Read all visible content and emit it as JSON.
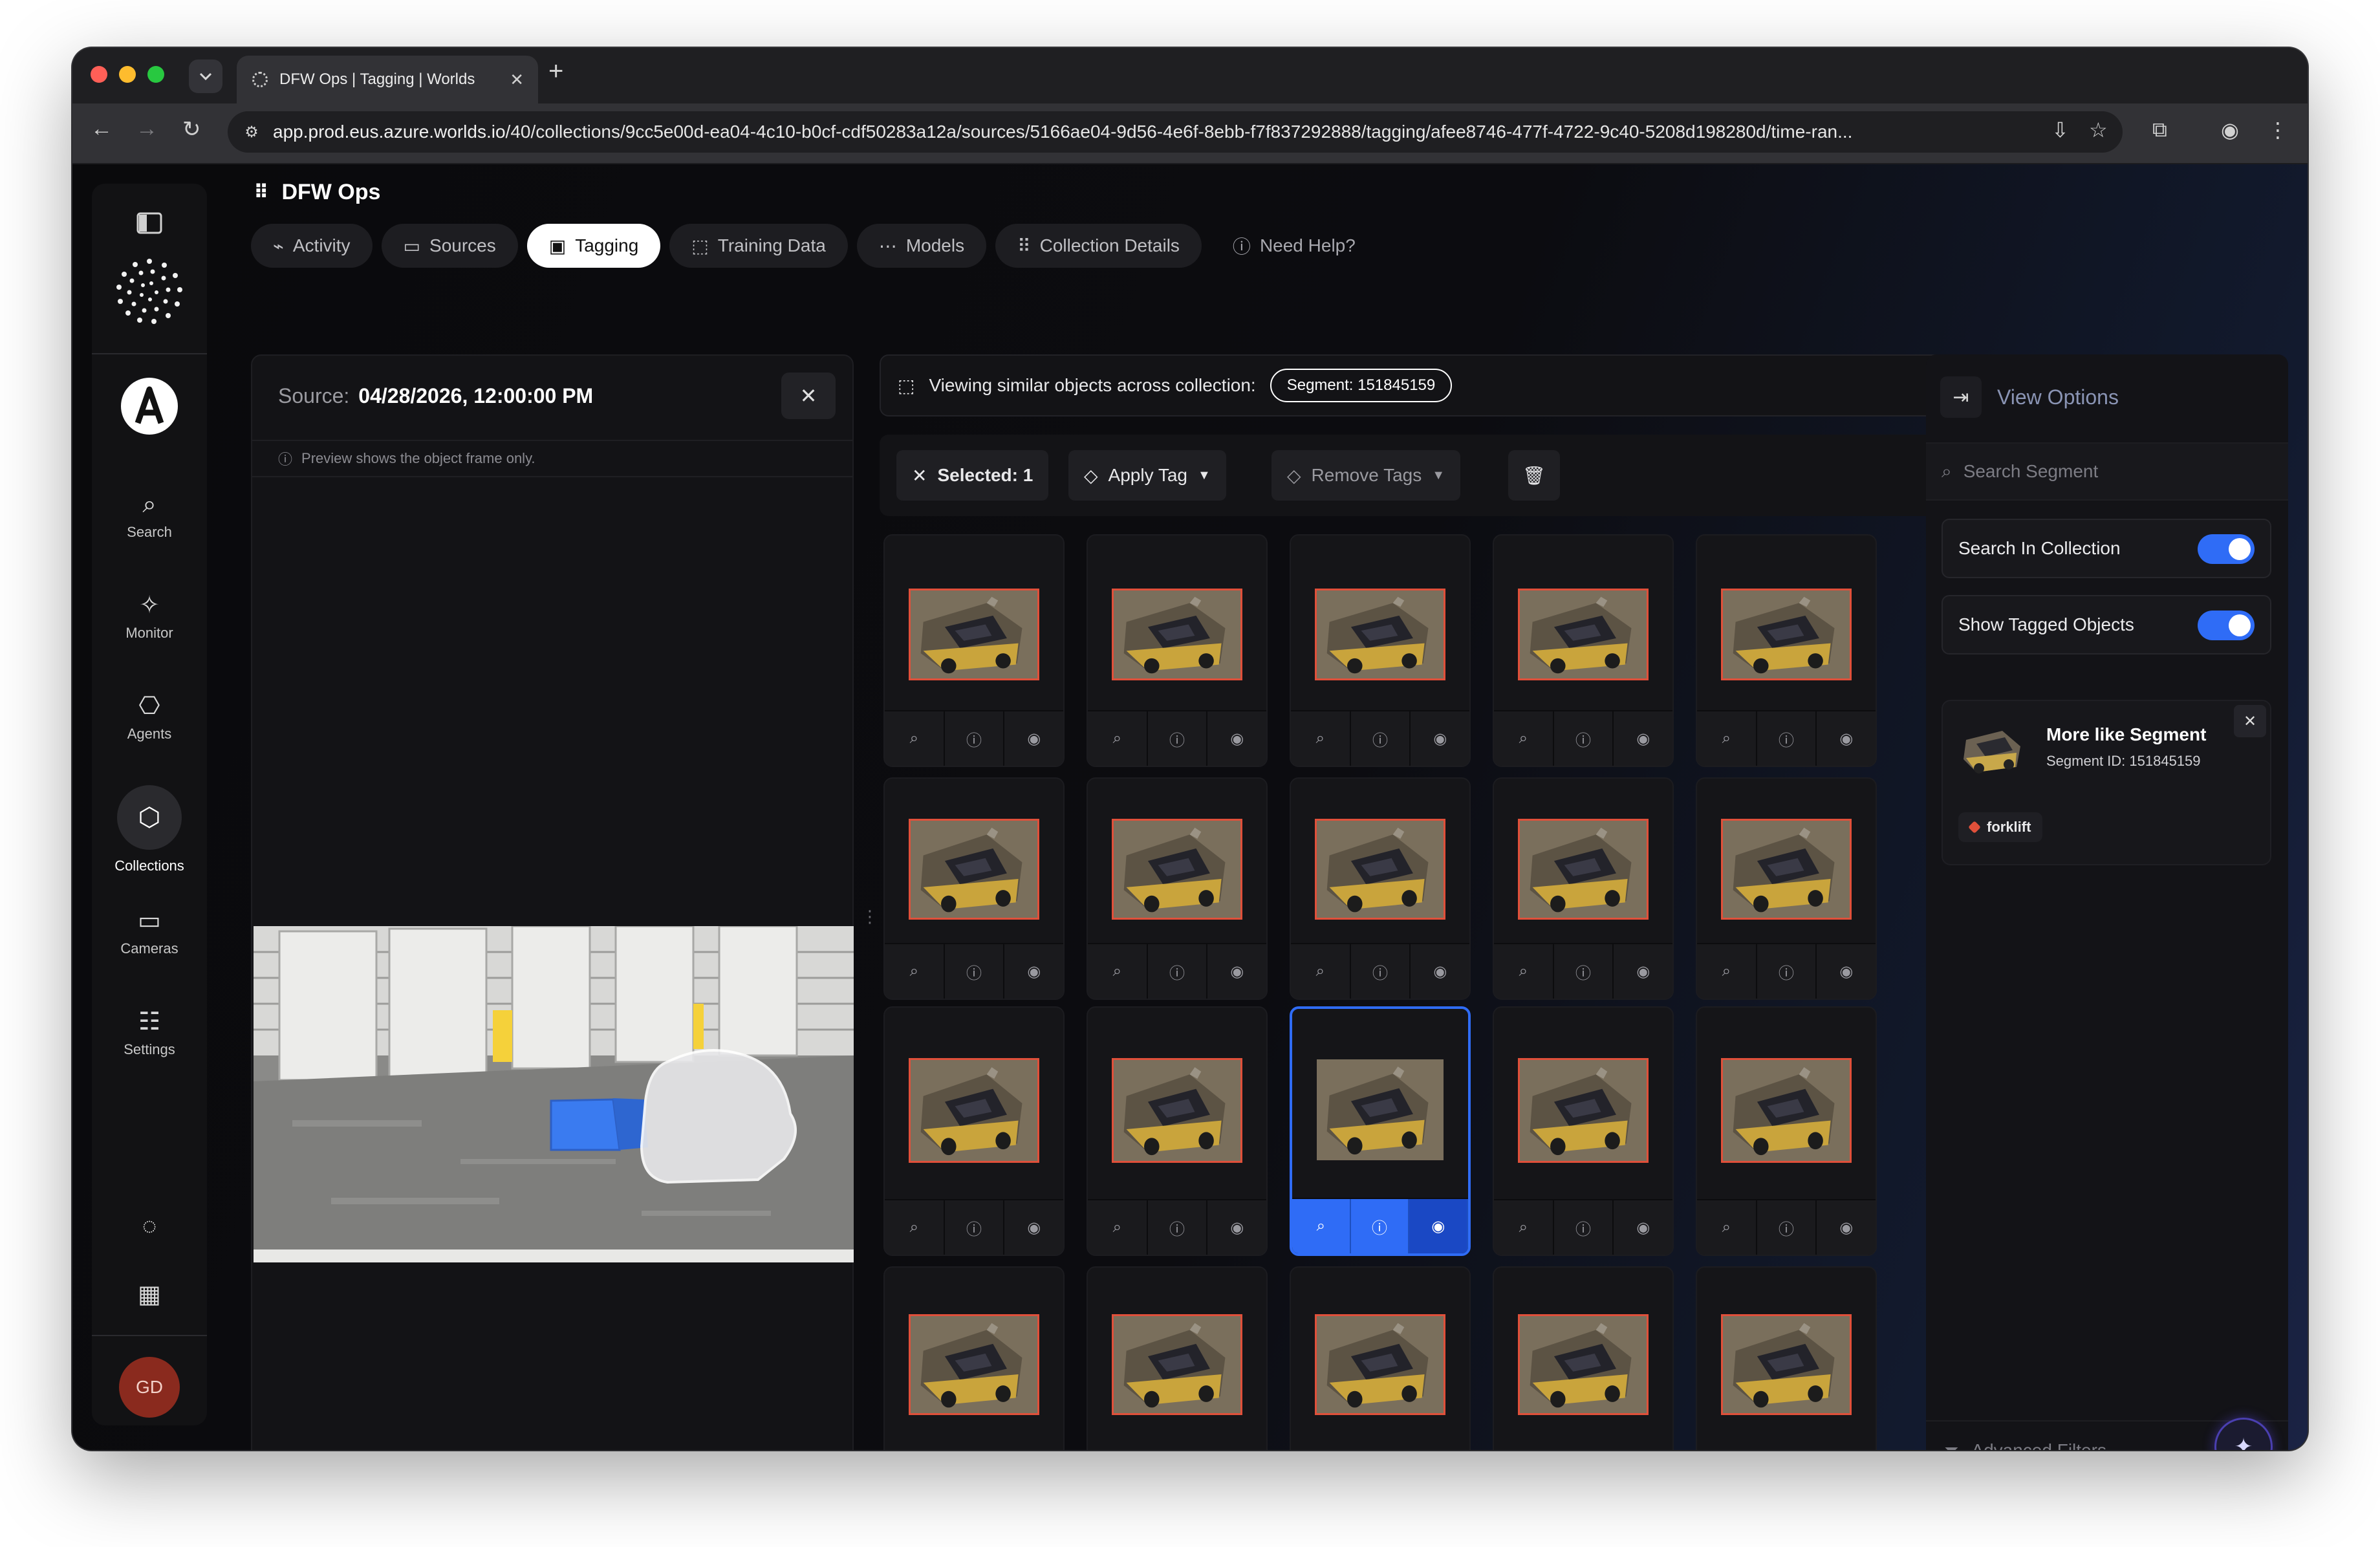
{
  "browser": {
    "tab_title": "DFW Ops | Tagging | Worlds",
    "url_host": "app.prod.eus.azure.worlds.io",
    "url_path": "/40/collections/9cc5e00d-ea04-4c10-b0cf-cdf50283a12a/sources/5166ae04-9d56-4e6f-8ebb-f7f837292888/tagging/afee8746-477f-4722-9c40-5208d198280d/time-ran...",
    "traffic_colors": [
      "#ff5f57",
      "#febc2e",
      "#28c840"
    ]
  },
  "sidebar": {
    "items": [
      {
        "label": "Search",
        "icon": "search-icon"
      },
      {
        "label": "Monitor",
        "icon": "monitor-icon"
      },
      {
        "label": "Agents",
        "icon": "robot-icon"
      },
      {
        "label": "Collections",
        "icon": "collections-icon"
      },
      {
        "label": "Cameras",
        "icon": "camera-icon"
      },
      {
        "label": "Settings",
        "icon": "sliders-icon"
      }
    ],
    "avatar_initials": "GD",
    "avatar_color": "#8a2a1e"
  },
  "header": {
    "title": "DFW Ops"
  },
  "nav_tabs": [
    {
      "label": "Activity"
    },
    {
      "label": "Sources"
    },
    {
      "label": "Tagging",
      "active": true
    },
    {
      "label": "Training Data"
    },
    {
      "label": "Models"
    },
    {
      "label": "Collection Details"
    },
    {
      "label": "Need Help?"
    }
  ],
  "source_panel": {
    "label": "Source:",
    "datetime": "04/28/2026, 12:00:00 PM",
    "note": "Preview shows the object frame only."
  },
  "similar_bar": {
    "text": "Viewing similar objects across collection:",
    "segment_badge": "Segment: 151845159"
  },
  "action_bar": {
    "selected": "Selected: 1",
    "apply_tag": "Apply Tag",
    "remove_tags": "Remove Tags"
  },
  "grid": {
    "selected_index": 12,
    "accent": "#2f6cf6",
    "box_color": "#e0503a"
  },
  "right_panel": {
    "view_options": "View Options",
    "search_placeholder": "Search Segment",
    "toggle_search_in_collection": "Search In Collection",
    "toggle_show_tagged": "Show Tagged Objects",
    "more_like_title": "More like Segment",
    "more_like_sub": "Segment ID: 151845159",
    "tag_label": "forklift",
    "advanced_filters": "Advanced Filters"
  }
}
